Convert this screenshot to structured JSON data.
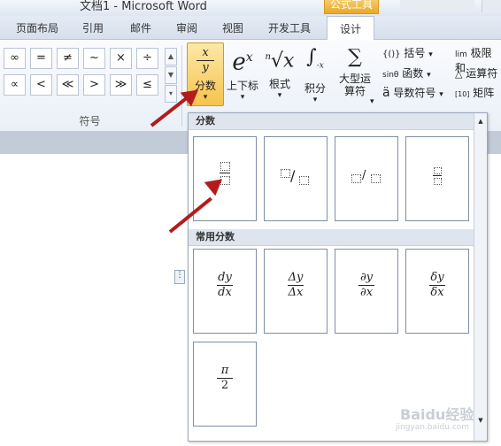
{
  "window": {
    "title": "文档1 - Microsoft Word",
    "context_tab": "公式工具"
  },
  "tabs": [
    {
      "label": "页面布局"
    },
    {
      "label": "引用"
    },
    {
      "label": "邮件"
    },
    {
      "label": "审阅"
    },
    {
      "label": "视图"
    },
    {
      "label": "开发工具"
    },
    {
      "label": "设计",
      "active": true
    }
  ],
  "symbols": {
    "items": [
      "∞",
      "=",
      "≠",
      "~",
      "×",
      "÷",
      "∝",
      "<",
      "≪",
      ">",
      "≫",
      "≤"
    ],
    "group_label": "符号"
  },
  "structures": [
    {
      "label": "分数",
      "icon": "fraction-icon",
      "arrow": "▾"
    },
    {
      "label": "上下标",
      "icon": "script-icon",
      "arrow": "▾"
    },
    {
      "label": "根式",
      "icon": "radical-icon",
      "arrow": "▾"
    },
    {
      "label": "积分",
      "icon": "integral-icon",
      "arrow": "▾"
    },
    {
      "label": "大型运算符",
      "icon": "large-operator-icon",
      "arrow": "▾"
    }
  ],
  "small_commands": [
    {
      "label": "括号",
      "prefix": "{()}",
      "arrow": "▾"
    },
    {
      "label": "函数",
      "prefix": "sinθ",
      "arrow": "▾"
    },
    {
      "label": "导数符号",
      "prefix": "ä",
      "arrow": "▾"
    },
    {
      "label": "极限和",
      "prefix": "lim"
    },
    {
      "label": "运算符",
      "prefix": "△"
    },
    {
      "label": "矩阵",
      "prefix": "[10]"
    }
  ],
  "dropdown": {
    "section1_title": "分数",
    "section2_title": "常用分数",
    "common": [
      {
        "num": "dy",
        "den": "dx"
      },
      {
        "num": "Δy",
        "den": "Δx"
      },
      {
        "num": "∂y",
        "den": "∂x"
      },
      {
        "num": "δy",
        "den": "δx"
      },
      {
        "num": "π",
        "den": "2"
      }
    ],
    "scroll_up": "▲",
    "scroll_down": "▼"
  },
  "colors": {
    "accent": "#f6c34e",
    "arrow": "#b31c1c"
  },
  "watermark": {
    "text": "Baidu经验",
    "url_text": "jingyan.baidu.com"
  }
}
